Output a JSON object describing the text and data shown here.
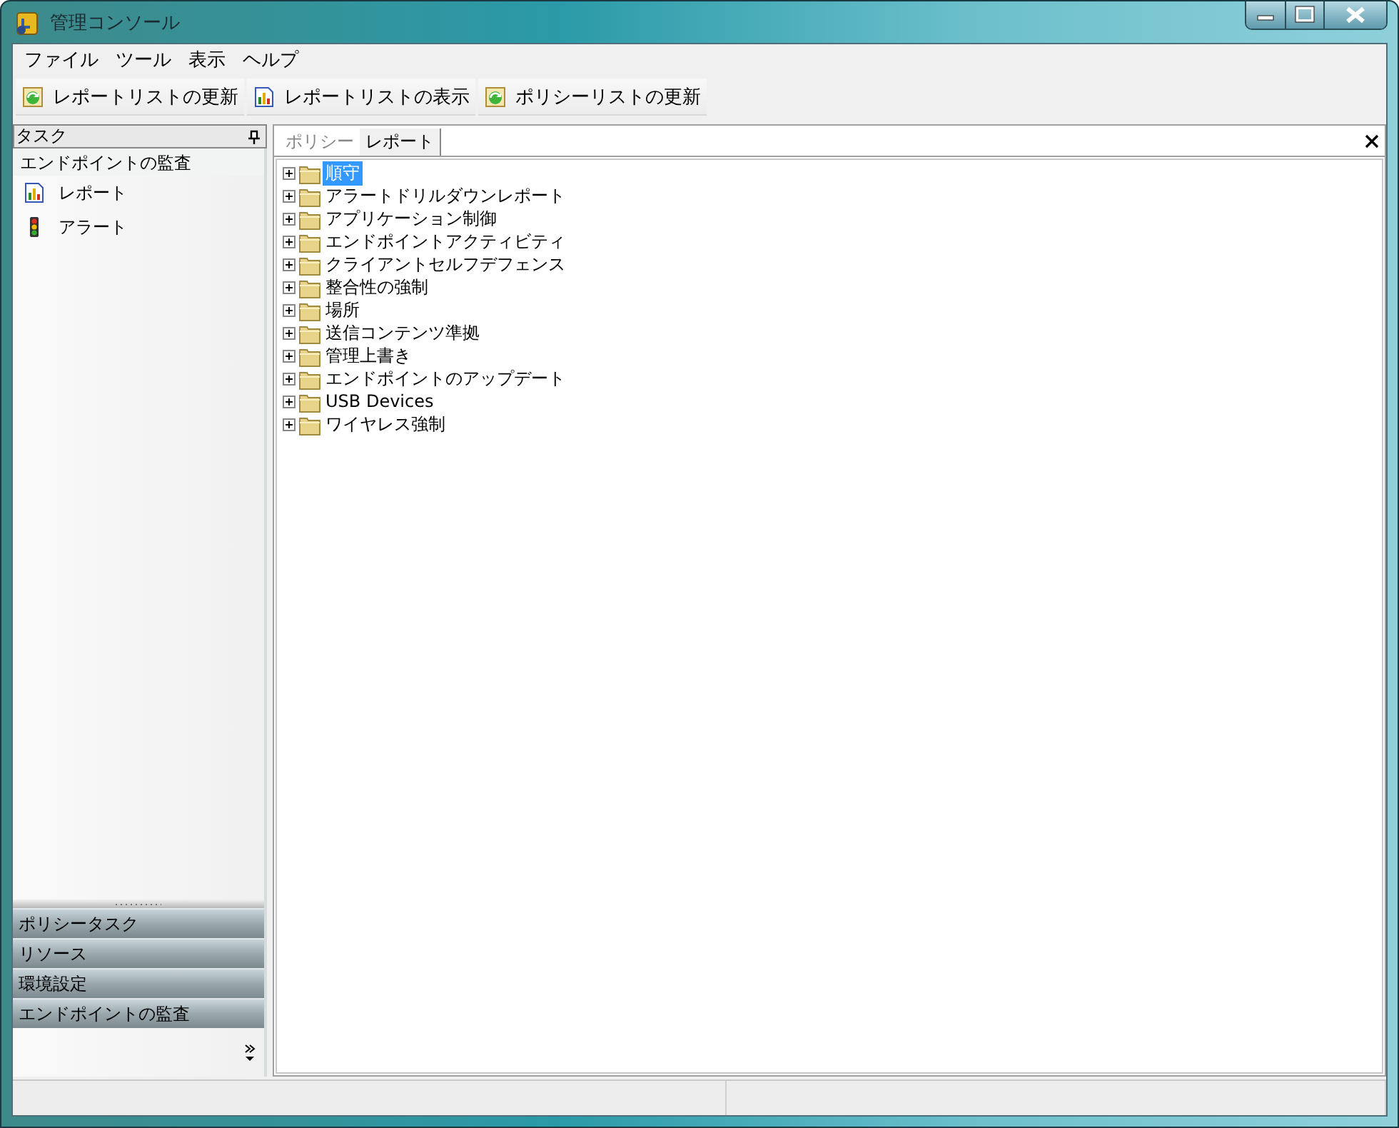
{
  "window": {
    "title": "管理コンソール"
  },
  "menu": [
    {
      "label": "ファイル"
    },
    {
      "label": "ツール"
    },
    {
      "label": "表示"
    },
    {
      "label": "ヘルプ"
    }
  ],
  "toolbar": [
    {
      "label": "レポートリストの更新",
      "kind": "refresh"
    },
    {
      "label": "レポートリストの表示",
      "kind": "report"
    },
    {
      "label": "ポリシーリストの更新",
      "kind": "refresh"
    }
  ],
  "task_pane": {
    "title": "タスク",
    "section": "エンドポイントの監査",
    "items": [
      {
        "label": "レポート",
        "kind": "report"
      },
      {
        "label": "アラート",
        "kind": "alert"
      }
    ],
    "nav": [
      {
        "label": "ポリシータスク"
      },
      {
        "label": "リソース"
      },
      {
        "label": "環境設定"
      },
      {
        "label": "エンドポイントの監査"
      }
    ]
  },
  "tabs": [
    {
      "label": "ポリシー",
      "selected": false
    },
    {
      "label": "レポート",
      "selected": true
    }
  ],
  "tree": [
    {
      "label": "順守",
      "selected": true,
      "expanded": false
    },
    {
      "label": "アラートドリルダウンレポート",
      "selected": false,
      "expanded": false
    },
    {
      "label": "アプリケーション制御",
      "selected": false,
      "expanded": false
    },
    {
      "label": "エンドポイントアクティビティ",
      "selected": false,
      "expanded": false
    },
    {
      "label": "クライアントセルフデフェンス",
      "selected": false,
      "expanded": false
    },
    {
      "label": "整合性の強制",
      "selected": false,
      "expanded": false
    },
    {
      "label": "場所",
      "selected": false,
      "expanded": false
    },
    {
      "label": "送信コンテンツ準拠",
      "selected": false,
      "expanded": false
    },
    {
      "label": "管理上書き",
      "selected": false,
      "expanded": false
    },
    {
      "label": "エンドポイントのアップデート",
      "selected": false,
      "expanded": false
    },
    {
      "label": "USB Devices",
      "selected": false,
      "expanded": false
    },
    {
      "label": "ワイヤレス強制",
      "selected": false,
      "expanded": false
    }
  ]
}
